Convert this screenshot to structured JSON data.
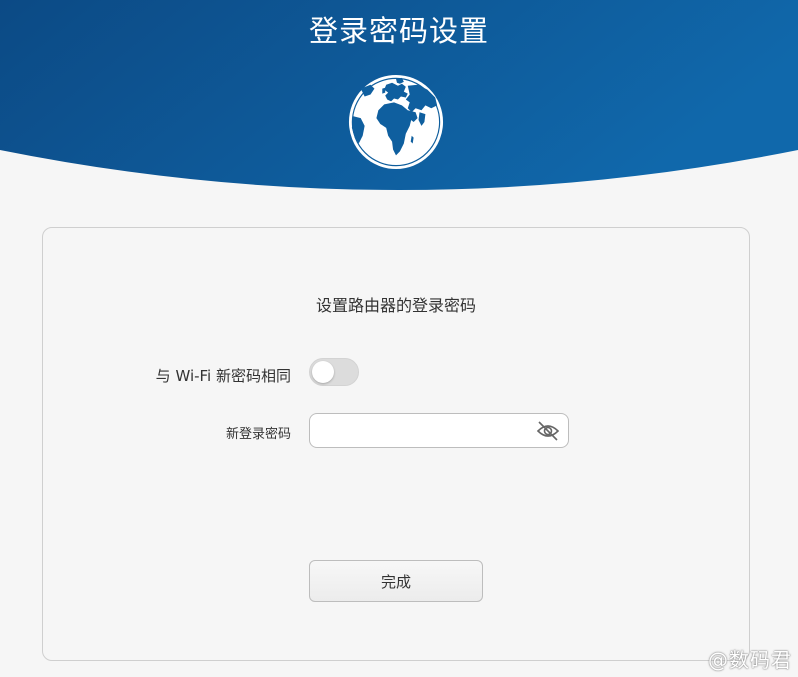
{
  "header": {
    "title": "登录密码设置",
    "bg_top": "#0d4a86",
    "bg_bottom": "#0f66a8"
  },
  "card": {
    "subtitle": "设置路由器的登录密码",
    "same_as_wifi": {
      "label": "与 Wi-Fi 新密码相同",
      "checked": false
    },
    "new_password": {
      "label": "新登录密码",
      "value": "",
      "placeholder": ""
    },
    "done_label": "完成"
  },
  "icons": {
    "globe": "globe-icon",
    "eye": "eye-off-icon"
  },
  "watermark": "@数码君"
}
